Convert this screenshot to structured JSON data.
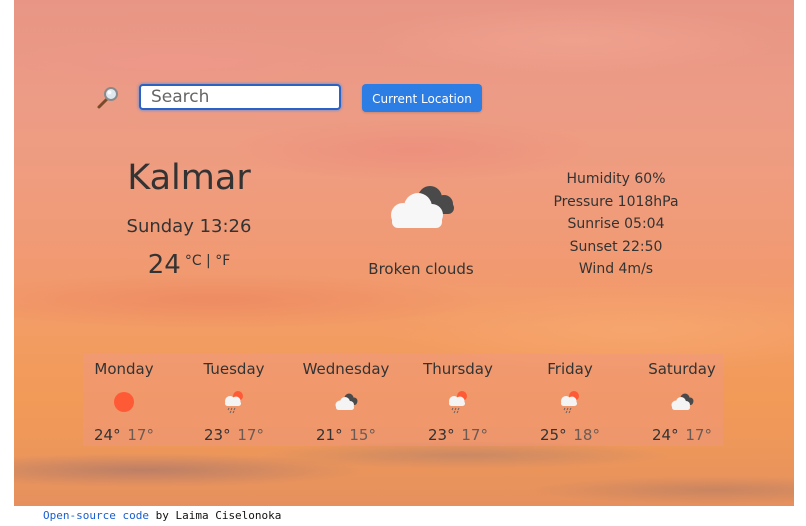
{
  "search": {
    "placeholder": "Search",
    "icon": "magnifying-glass-icon"
  },
  "current_location_label": "Current Location",
  "current": {
    "city": "Kalmar",
    "datetime": "Sunday 13:26",
    "temperature": "24",
    "units": "°C | °F",
    "icon": "broken-clouds-icon",
    "description": "Broken clouds",
    "humidity": "Humidity 60%",
    "pressure": "Pressure 1018hPa",
    "sunrise": "Sunrise 05:04",
    "sunset": "Sunset 22:50",
    "wind": "Wind 4m/s"
  },
  "forecast": [
    {
      "day": "Monday",
      "icon": "sun-icon",
      "max": "24°",
      "min": "17°"
    },
    {
      "day": "Tuesday",
      "icon": "sun-rain-cloud-icon",
      "max": "23°",
      "min": "17°"
    },
    {
      "day": "Wednesday",
      "icon": "broken-clouds-icon",
      "max": "21°",
      "min": "15°"
    },
    {
      "day": "Thursday",
      "icon": "sun-rain-cloud-icon",
      "max": "23°",
      "min": "17°"
    },
    {
      "day": "Friday",
      "icon": "sun-rain-cloud-icon",
      "max": "25°",
      "min": "18°"
    },
    {
      "day": "Saturday",
      "icon": "broken-clouds-icon",
      "max": "24°",
      "min": "17°"
    }
  ],
  "footer": {
    "link_text": "Open-source code",
    "text": " by Laima Ciselonoka"
  },
  "colors": {
    "accent": "#2c7de4",
    "sun": "#ff5a36",
    "text": "#333333"
  }
}
